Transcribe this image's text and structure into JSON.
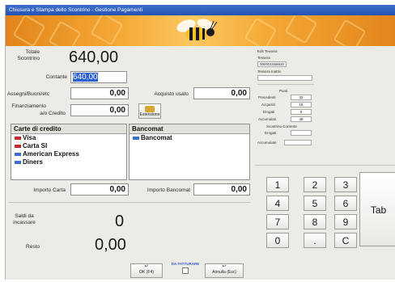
{
  "window": {
    "title": "Chiusura e Stampa dello Scontrino - Gestione Pagamenti"
  },
  "totals": {
    "total_label": "Totale Scontrino",
    "total_value": "640,00",
    "balance_label": "Saldi da incassare",
    "balance_value": "0",
    "change_label": "Resto",
    "change_value": "0,00"
  },
  "fields": {
    "cash_label": "Contante",
    "cash_value": "640,00",
    "assigned_label": "Assegni/Buoni/etc",
    "assigned_value": "0,00",
    "used_purchase_label": "Acquisto usato",
    "used_purchase_value": "0,00",
    "financing_label": "Finanziamento",
    "credit_label": "a/o Credito",
    "financing_value": "0,00",
    "financing_button_label": "Estensione"
  },
  "cards": {
    "credit_header": "Carte di credito",
    "credit_items": [
      "Visa",
      "Carta SI",
      "American Express",
      "Diners"
    ],
    "bancomat_header": "Bancomat",
    "bancomat_items": [
      "Bancomat"
    ],
    "card_amount_label": "Importo Carta",
    "card_amount_value": "0,00",
    "bancomat_amount_label": "Importo Bancomat",
    "bancomat_amount_value": "0,00"
  },
  "info": {
    "receipt_label": "Edit Tessera",
    "card_label": "Tessera",
    "card_code": "000001558630",
    "card_holder_label": "Tessera Inattiv",
    "points_label": "Punti",
    "previous_label": "Precedenti",
    "previous_value": "32",
    "earned_label": "Acquisiti",
    "earned_value": "16",
    "redeemed_label": "Erogati",
    "redeemed_value": "0",
    "accumulated_label": "Accumulati",
    "accumulated_value": "48",
    "voucher_label": "Scontrino Corrente",
    "used_label": "Erogati",
    "accumulate_label": "Accumulate"
  },
  "keypad": [
    "1",
    "2",
    "3",
    "4",
    "5",
    "6",
    "7",
    "8",
    "9",
    "0",
    ".",
    "C"
  ],
  "keypad_tab": "Tab",
  "actions": {
    "ok_label": "OK (F4)",
    "invoice_label": "DA FATTURARE",
    "cancel_label": "Annulla (Esc)"
  }
}
